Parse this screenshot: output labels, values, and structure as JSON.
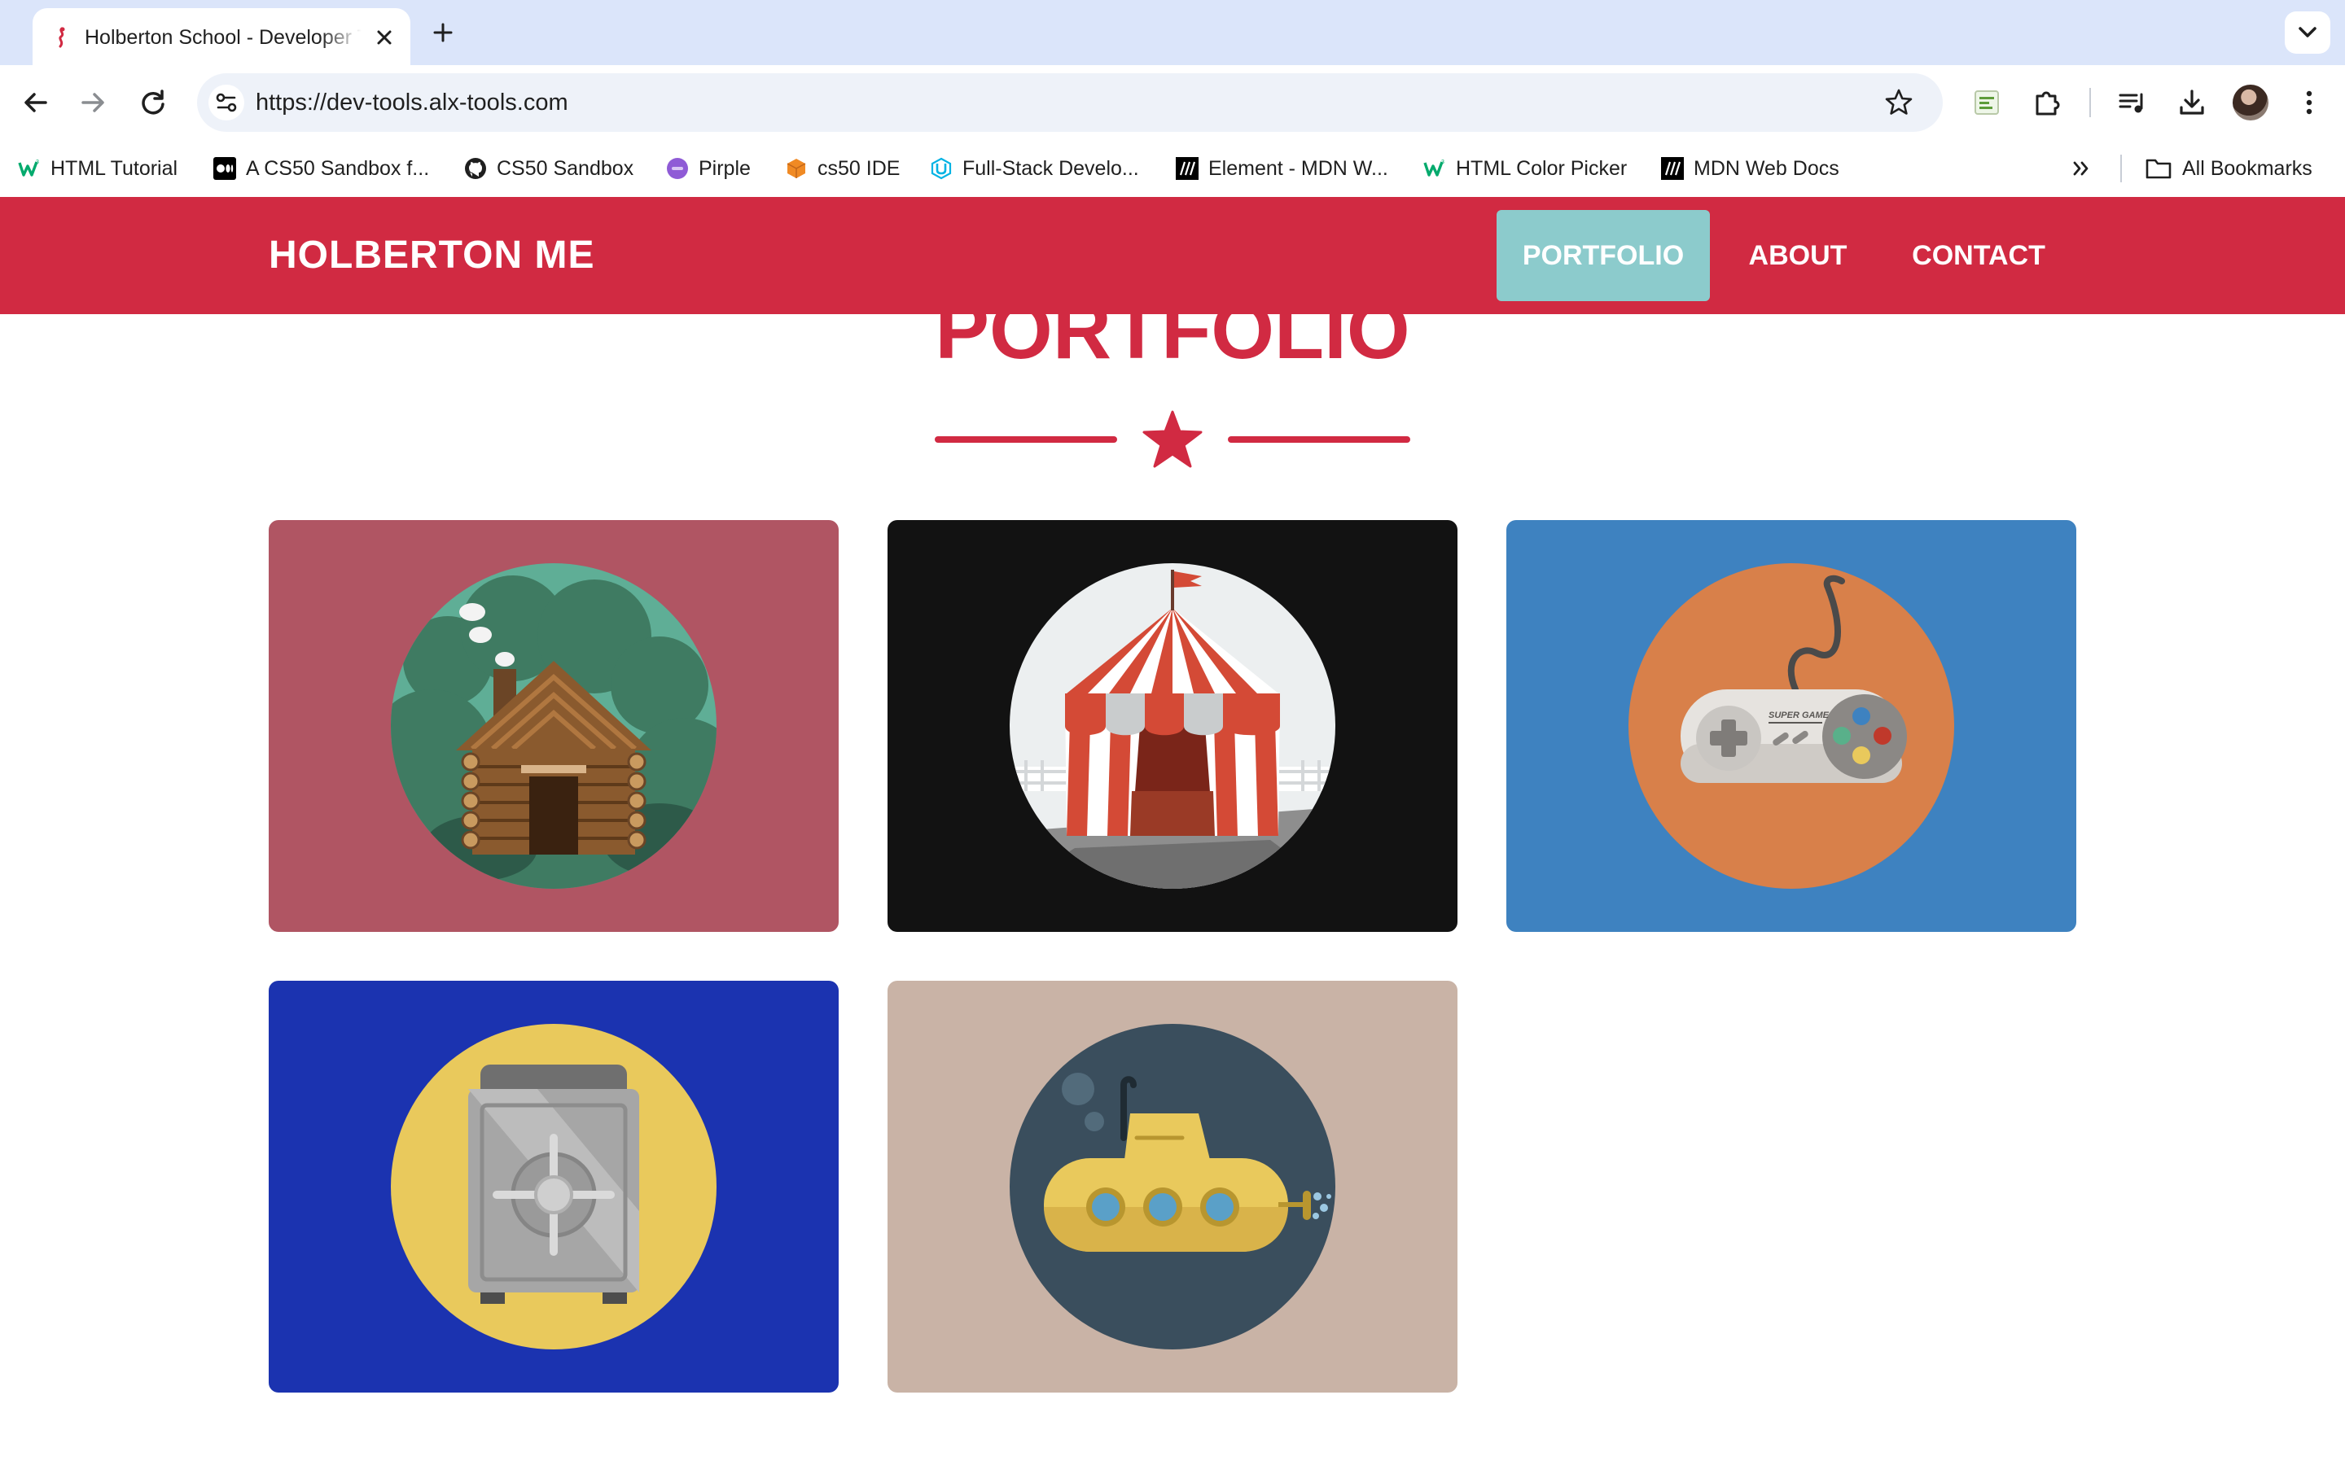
{
  "browser": {
    "tab": {
      "title": "Holberton School - Developer Tools",
      "close_label": "close tab"
    },
    "new_tab_label": "new tab",
    "url": "https://dev-tools.alx-tools.com",
    "bookmarks": [
      {
        "label": "HTML Tutorial",
        "icon": "w3schools-icon"
      },
      {
        "label": "A CS50 Sandbox f...",
        "icon": "medium-icon"
      },
      {
        "label": "CS50 Sandbox",
        "icon": "github-icon"
      },
      {
        "label": "Pirple",
        "icon": "pirple-icon"
      },
      {
        "label": "cs50 IDE",
        "icon": "cube-icon"
      },
      {
        "label": "Full-Stack Develo...",
        "icon": "udacity-icon"
      },
      {
        "label": "Element - MDN W...",
        "icon": "mdn-icon"
      },
      {
        "label": "HTML Color Picker",
        "icon": "w3schools-icon"
      },
      {
        "label": "MDN Web Docs",
        "icon": "mdn-icon"
      }
    ],
    "all_bookmarks_label": "All Bookmarks"
  },
  "site": {
    "brand": "HOLBERTON ME",
    "nav": [
      {
        "label": "PORTFOLIO",
        "active": true
      },
      {
        "label": "ABOUT",
        "active": false
      },
      {
        "label": "CONTACT",
        "active": false
      }
    ],
    "section_title": "PORTFOLIO",
    "portfolio_items": [
      {
        "name": "cabin",
        "background": "#b05563",
        "circle": "#5fae96"
      },
      {
        "name": "circus-tent",
        "background": "#121212",
        "circle": "#eceff0"
      },
      {
        "name": "game-controller",
        "background": "#3e82c0",
        "circle": "#d8804a"
      },
      {
        "name": "safe",
        "background": "#1b33b0",
        "circle": "#e9c95c"
      },
      {
        "name": "submarine",
        "background": "#c9b3a6",
        "circle": "#3a4e5d"
      }
    ]
  },
  "colors": {
    "tab_strip": "#dbe5fa",
    "header": "#d12a42",
    "nav_active": "#8ccbcc",
    "accent": "#d12a42"
  }
}
